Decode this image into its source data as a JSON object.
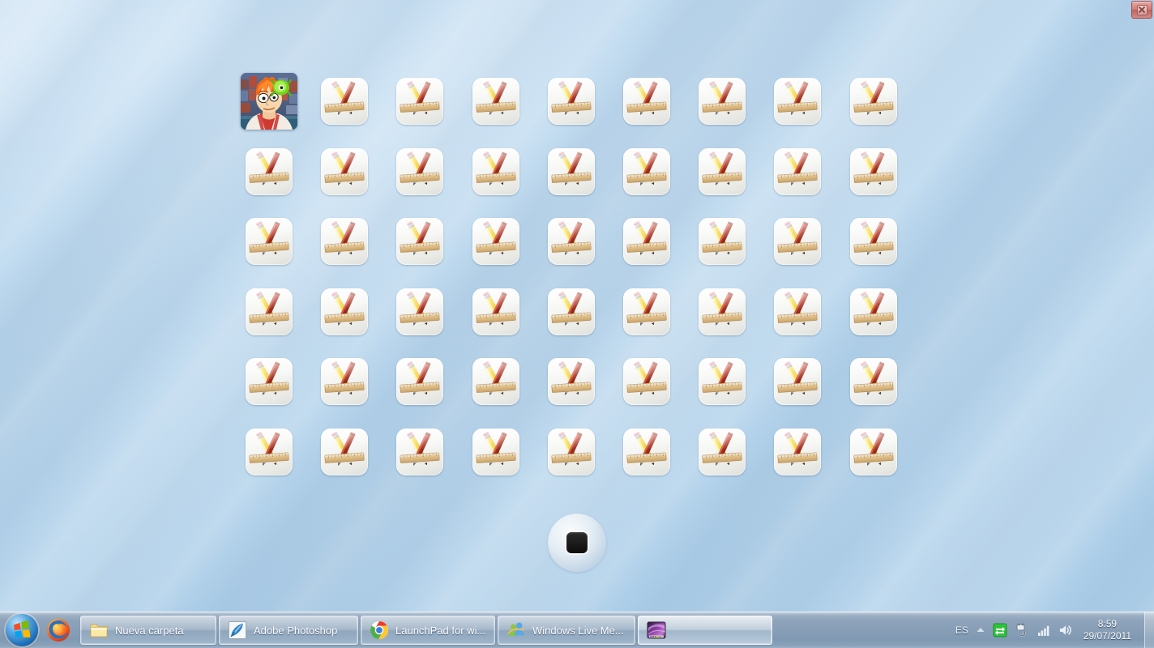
{
  "window": {
    "title": "LaunchPad for Windows",
    "close_label": "Close",
    "close_icon": "close-icon"
  },
  "launchpad": {
    "background_color": "#b9d5ec",
    "columns": 9,
    "rows": 6,
    "page_indicator": {
      "icon": "page-dot-icon",
      "pages": 1,
      "current_page": 1
    },
    "items": [
      {
        "icon": "fry-meme-icon",
        "kind": "image",
        "label": ""
      },
      {
        "icon": "applications-folder-icon",
        "kind": "app",
        "label": ""
      },
      {
        "icon": "applications-folder-icon",
        "kind": "app",
        "label": ""
      },
      {
        "icon": "applications-folder-icon",
        "kind": "app",
        "label": ""
      },
      {
        "icon": "applications-folder-icon",
        "kind": "app",
        "label": ""
      },
      {
        "icon": "applications-folder-icon",
        "kind": "app",
        "label": ""
      },
      {
        "icon": "applications-folder-icon",
        "kind": "app",
        "label": ""
      },
      {
        "icon": "applications-folder-icon",
        "kind": "app",
        "label": ""
      },
      {
        "icon": "applications-folder-icon",
        "kind": "app",
        "label": ""
      },
      {
        "icon": "applications-folder-icon",
        "kind": "app",
        "label": ""
      },
      {
        "icon": "applications-folder-icon",
        "kind": "app",
        "label": ""
      },
      {
        "icon": "applications-folder-icon",
        "kind": "app",
        "label": ""
      },
      {
        "icon": "applications-folder-icon",
        "kind": "app",
        "label": ""
      },
      {
        "icon": "applications-folder-icon",
        "kind": "app",
        "label": ""
      },
      {
        "icon": "applications-folder-icon",
        "kind": "app",
        "label": ""
      },
      {
        "icon": "applications-folder-icon",
        "kind": "app",
        "label": ""
      },
      {
        "icon": "applications-folder-icon",
        "kind": "app",
        "label": ""
      },
      {
        "icon": "applications-folder-icon",
        "kind": "app",
        "label": ""
      },
      {
        "icon": "applications-folder-icon",
        "kind": "app",
        "label": ""
      },
      {
        "icon": "applications-folder-icon",
        "kind": "app",
        "label": ""
      },
      {
        "icon": "applications-folder-icon",
        "kind": "app",
        "label": ""
      },
      {
        "icon": "applications-folder-icon",
        "kind": "app",
        "label": ""
      },
      {
        "icon": "applications-folder-icon",
        "kind": "app",
        "label": ""
      },
      {
        "icon": "applications-folder-icon",
        "kind": "app",
        "label": ""
      },
      {
        "icon": "applications-folder-icon",
        "kind": "app",
        "label": ""
      },
      {
        "icon": "applications-folder-icon",
        "kind": "app",
        "label": ""
      },
      {
        "icon": "applications-folder-icon",
        "kind": "app",
        "label": ""
      },
      {
        "icon": "applications-folder-icon",
        "kind": "app",
        "label": ""
      },
      {
        "icon": "applications-folder-icon",
        "kind": "app",
        "label": ""
      },
      {
        "icon": "applications-folder-icon",
        "kind": "app",
        "label": ""
      },
      {
        "icon": "applications-folder-icon",
        "kind": "app",
        "label": ""
      },
      {
        "icon": "applications-folder-icon",
        "kind": "app",
        "label": ""
      },
      {
        "icon": "applications-folder-icon",
        "kind": "app",
        "label": ""
      },
      {
        "icon": "applications-folder-icon",
        "kind": "app",
        "label": ""
      },
      {
        "icon": "applications-folder-icon",
        "kind": "app",
        "label": ""
      },
      {
        "icon": "applications-folder-icon",
        "kind": "app",
        "label": ""
      },
      {
        "icon": "applications-folder-icon",
        "kind": "app",
        "label": ""
      },
      {
        "icon": "applications-folder-icon",
        "kind": "app",
        "label": ""
      },
      {
        "icon": "applications-folder-icon",
        "kind": "app",
        "label": ""
      },
      {
        "icon": "applications-folder-icon",
        "kind": "app",
        "label": ""
      },
      {
        "icon": "applications-folder-icon",
        "kind": "app",
        "label": ""
      },
      {
        "icon": "applications-folder-icon",
        "kind": "app",
        "label": ""
      },
      {
        "icon": "applications-folder-icon",
        "kind": "app",
        "label": ""
      },
      {
        "icon": "applications-folder-icon",
        "kind": "app",
        "label": ""
      },
      {
        "icon": "applications-folder-icon",
        "kind": "app",
        "label": ""
      },
      {
        "icon": "applications-folder-icon",
        "kind": "app",
        "label": ""
      },
      {
        "icon": "applications-folder-icon",
        "kind": "app",
        "label": ""
      },
      {
        "icon": "applications-folder-icon",
        "kind": "app",
        "label": ""
      },
      {
        "icon": "applications-folder-icon",
        "kind": "app",
        "label": ""
      },
      {
        "icon": "applications-folder-icon",
        "kind": "app",
        "label": ""
      },
      {
        "icon": "applications-folder-icon",
        "kind": "app",
        "label": ""
      },
      {
        "icon": "applications-folder-icon",
        "kind": "app",
        "label": ""
      },
      {
        "icon": "applications-folder-icon",
        "kind": "app",
        "label": ""
      },
      {
        "icon": "applications-folder-icon",
        "kind": "app",
        "label": ""
      }
    ]
  },
  "taskbar": {
    "start": {
      "label": "Start",
      "icon": "windows-start-orb-icon"
    },
    "quick_launch": [
      {
        "label": "Mozilla Firefox",
        "icon": "firefox-icon"
      }
    ],
    "buttons": [
      {
        "label": "Nueva carpeta",
        "icon": "folder-icon",
        "active": false
      },
      {
        "label": "Adobe Photoshop",
        "icon": "photoshop-feather-icon",
        "active": false
      },
      {
        "label": "LaunchPad for wi...",
        "icon": "chrome-icon",
        "active": false
      },
      {
        "label": "Windows Live Me...",
        "icon": "windows-live-messenger-icon",
        "active": false
      },
      {
        "label": "",
        "icon": "macos-aurora-thumbnail-icon",
        "active": true
      }
    ],
    "tray": {
      "language": "ES",
      "show_hidden_icons": "show-hidden-icons-chevron-icon",
      "icons": [
        {
          "name": "network-sync-icon",
          "color": "#34c642"
        },
        {
          "name": "safely-remove-hardware-icon"
        },
        {
          "name": "network-signal-icon"
        },
        {
          "name": "volume-speaker-icon"
        }
      ]
    },
    "clock": {
      "time": "8:59",
      "date": "29/07/2011"
    },
    "show_desktop": {
      "label": "Show desktop"
    }
  }
}
